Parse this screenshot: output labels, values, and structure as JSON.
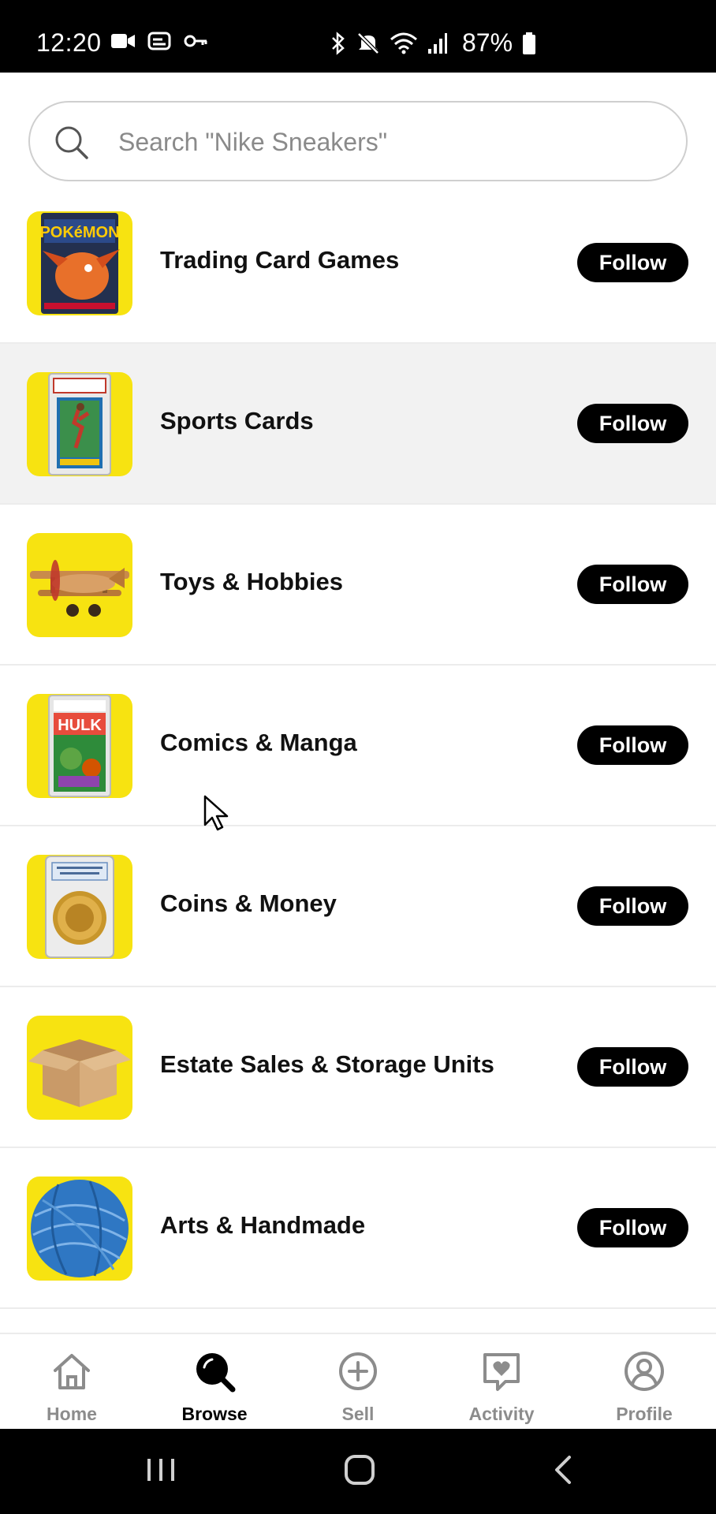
{
  "status_bar": {
    "time": "12:20",
    "battery": "87%",
    "icons": [
      "video-icon",
      "cast-icon",
      "key-icon",
      "bluetooth-icon",
      "mute-icon",
      "wifi-icon",
      "signal-icon",
      "battery-icon"
    ]
  },
  "search": {
    "placeholder": "Search \"Nike Sneakers\""
  },
  "categories": [
    {
      "name": "Trading Card Games",
      "follow_label": "Follow",
      "thumb_icon": "pokemon-card-pack-icon"
    },
    {
      "name": "Sports Cards",
      "follow_label": "Follow",
      "thumb_icon": "graded-sports-card-icon"
    },
    {
      "name": "Toys & Hobbies",
      "follow_label": "Follow",
      "thumb_icon": "toy-airplane-icon"
    },
    {
      "name": "Comics & Manga",
      "follow_label": "Follow",
      "thumb_icon": "comic-book-icon"
    },
    {
      "name": "Coins & Money",
      "follow_label": "Follow",
      "thumb_icon": "graded-coin-icon"
    },
    {
      "name": "Estate Sales & Storage Units",
      "follow_label": "Follow",
      "thumb_icon": "cardboard-box-icon"
    },
    {
      "name": "Arts & Handmade",
      "follow_label": "Follow",
      "thumb_icon": "yarn-ball-icon"
    }
  ],
  "bottom_nav": {
    "items": [
      {
        "label": "Home",
        "icon": "home-icon"
      },
      {
        "label": "Browse",
        "icon": "browse-search-icon",
        "active": true
      },
      {
        "label": "Sell",
        "icon": "plus-circle-icon"
      },
      {
        "label": "Activity",
        "icon": "heart-chat-icon"
      },
      {
        "label": "Profile",
        "icon": "user-circle-icon"
      }
    ]
  },
  "colors": {
    "accent_yellow": "#f7e311",
    "follow_button": "#000000",
    "highlight_row": "#f2f2f2",
    "inactive_nav": "#8c8c8c"
  }
}
